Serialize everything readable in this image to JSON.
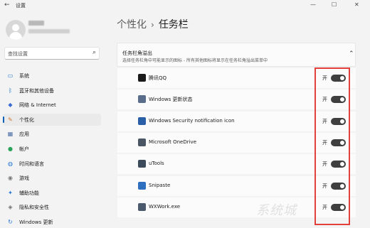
{
  "window": {
    "title": "设置",
    "back": "←",
    "minimize": "—",
    "maximize": "☐",
    "close": "✕"
  },
  "search": {
    "placeholder": "查找设置",
    "icon": "search-icon"
  },
  "nav": [
    {
      "label": "系统",
      "icon": "monitor-icon",
      "color": "#1f74d6"
    },
    {
      "label": "蓝牙和其他设备",
      "icon": "bluetooth-icon",
      "color": "#0067c0"
    },
    {
      "label": "网络 & Internet",
      "icon": "wifi-icon",
      "color": "#3a6cd4"
    },
    {
      "label": "个性化",
      "icon": "pencil-icon",
      "color": "#d2772a",
      "active": true
    },
    {
      "label": "应用",
      "icon": "apps-icon",
      "color": "#4a6fa5"
    },
    {
      "label": "帐户",
      "icon": "person-icon",
      "color": "#2aa35a"
    },
    {
      "label": "时间和语言",
      "icon": "globe-clock-icon",
      "color": "#1f74d6"
    },
    {
      "label": "游戏",
      "icon": "gamepad-icon",
      "color": "#7a7a7a"
    },
    {
      "label": "辅助功能",
      "icon": "accessibility-icon",
      "color": "#1f74d6"
    },
    {
      "label": "隐私和安全性",
      "icon": "shield-icon",
      "color": "#707070"
    },
    {
      "label": "Windows 更新",
      "icon": "update-icon",
      "color": "#1f74d6"
    }
  ],
  "header": {
    "parent": "个性化",
    "separator": "›",
    "current": "任务栏"
  },
  "section": {
    "title": "任务栏角溢出",
    "description": "选择任务栏角中可能显示的图标 - 所有其他图标将显示在任务栏角溢出菜单中",
    "chevron": "⌃"
  },
  "apps": [
    {
      "name": "腾讯QQ",
      "state": "开",
      "icon_color": "#1a1a1a",
      "icon": "qq-icon"
    },
    {
      "name": "Windows 更新状态",
      "state": "开",
      "icon_color": "#5a6e8c",
      "icon": "windows-update-icon"
    },
    {
      "name": "Windows Security notification icon",
      "state": "开",
      "icon_color": "#2b5fa8",
      "icon": "security-shield-icon"
    },
    {
      "name": "Microsoft OneDrive",
      "state": "开",
      "icon_color": "#4a5663",
      "icon": "onedrive-icon"
    },
    {
      "name": "uTools",
      "state": "开",
      "icon_color": "#3c4b5c",
      "icon": "utools-icon"
    },
    {
      "name": "Snipaste",
      "state": "开",
      "icon_color": "#2f6fbf",
      "icon": "snipaste-icon"
    },
    {
      "name": "WXWork.exe",
      "state": "开",
      "icon_color": "#4b5a6c",
      "icon": "wxwork-icon"
    }
  ],
  "watermark": "系统城",
  "colors": {
    "accent": "#005fb8",
    "toggle_on": "#3f3f3f",
    "highlight": "#e1403b"
  }
}
